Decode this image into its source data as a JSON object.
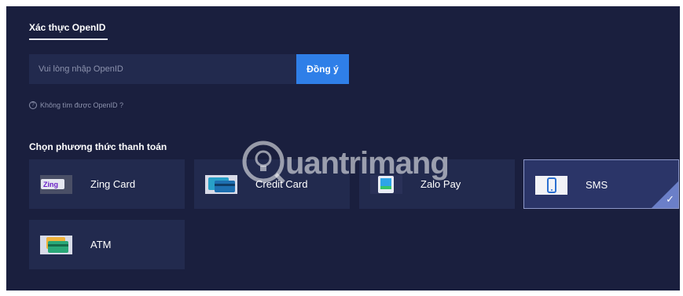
{
  "verify": {
    "tab_title": "Xác thực OpenID",
    "input_placeholder": "Vui lòng nhập OpenID",
    "input_value": "",
    "submit_label": "Đồng ý",
    "help_text": "Không tìm được OpenID ?"
  },
  "payment": {
    "section_title": "Chọn phương thức thanh toán",
    "methods": [
      {
        "label": "Zing Card",
        "icon": "zing-card-icon",
        "selected": false
      },
      {
        "label": "Credit Card",
        "icon": "credit-card-icon",
        "selected": false
      },
      {
        "label": "Zalo Pay",
        "icon": "zalo-pay-icon",
        "selected": false
      },
      {
        "label": "SMS",
        "icon": "sms-phone-icon",
        "selected": true
      },
      {
        "label": "ATM",
        "icon": "atm-card-icon",
        "selected": false
      }
    ]
  },
  "watermark": {
    "text": "uantrimang"
  },
  "colors": {
    "background": "#1a1f3e",
    "card": "#222a4e",
    "selected_card": "#2b3568",
    "accent": "#2f7fe8",
    "check": "#6b7fc8"
  }
}
